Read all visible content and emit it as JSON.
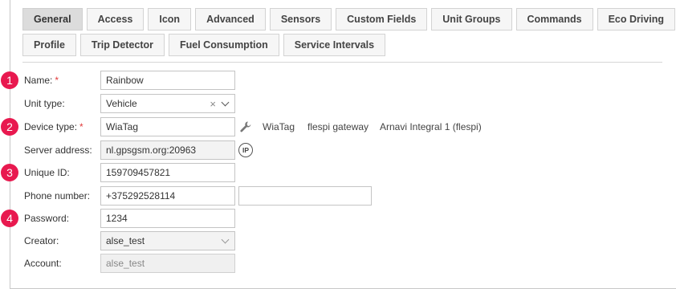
{
  "tabs_row1": [
    "General",
    "Access",
    "Icon",
    "Advanced",
    "Sensors",
    "Custom Fields",
    "Unit Groups",
    "Commands",
    "Eco Driving"
  ],
  "tabs_row2": [
    "Profile",
    "Trip Detector",
    "Fuel Consumption",
    "Service Intervals"
  ],
  "active_tab": "General",
  "form": {
    "name": {
      "badge": "1",
      "label": "Name:",
      "required": "*",
      "value": "Rainbow"
    },
    "unit_type": {
      "label": "Unit type:",
      "value": "Vehicle",
      "clear": "×"
    },
    "device_type": {
      "badge": "2",
      "label": "Device type:",
      "required": "*",
      "value": "WiaTag",
      "suggestions": [
        "WiaTag",
        "flespi gateway",
        "Arnavi Integral 1 (flespi)"
      ]
    },
    "server_address": {
      "label": "Server address:",
      "value": "nl.gpsgsm.org:20963",
      "ip_icon": "IP"
    },
    "unique_id": {
      "badge": "3",
      "label": "Unique ID:",
      "value": "159709457821"
    },
    "phone_number": {
      "label": "Phone number:",
      "value": "+375292528114",
      "value2": ""
    },
    "password": {
      "badge": "4",
      "label": "Password:",
      "value": "1234"
    },
    "creator": {
      "label": "Creator:",
      "value": "alse_test"
    },
    "account": {
      "label": "Account:",
      "value": "alse_test"
    }
  },
  "colors": {
    "badge": "#e8194f",
    "required": "#e23b3b",
    "active_tab": "#dcdcdc"
  }
}
